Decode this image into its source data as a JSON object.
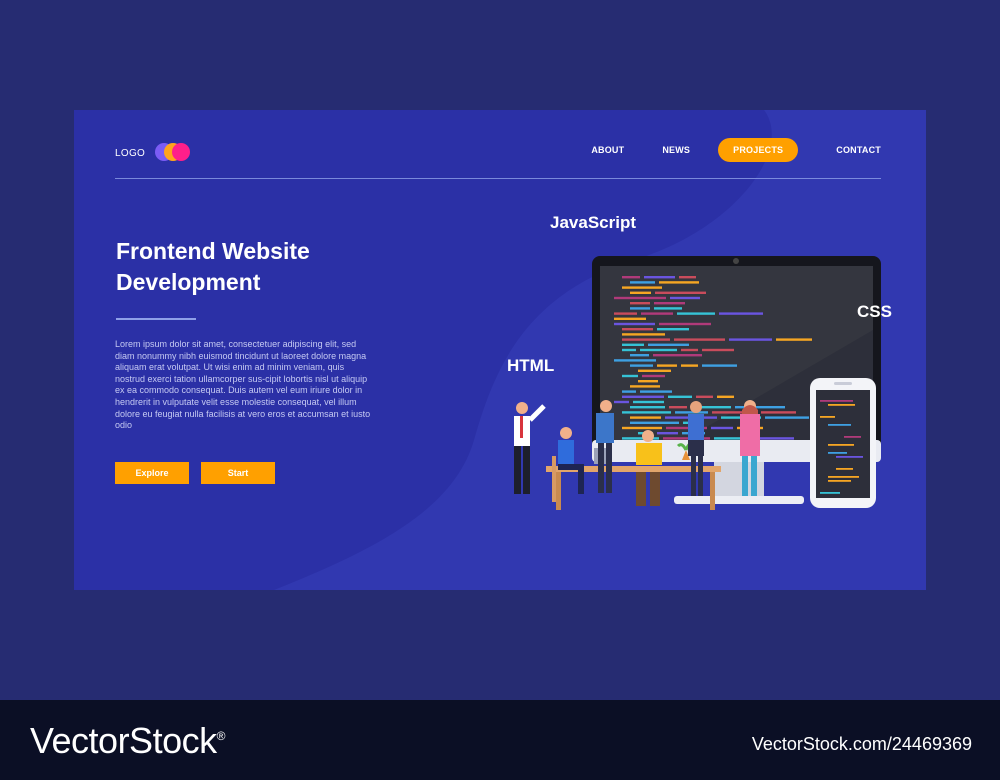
{
  "logo": {
    "text": "LOGO"
  },
  "nav": {
    "items": [
      {
        "label": "ABOUT",
        "active": false
      },
      {
        "label": "NEWS",
        "active": false
      },
      {
        "label": "PROJECTS",
        "active": true
      },
      {
        "label": "CONTACT",
        "active": false
      }
    ]
  },
  "hero": {
    "title": "Frontend Website Development",
    "body": "Lorem ipsum dolor sit amet, consectetuer adipiscing elit, sed diam nonummy nibh euismod tincidunt ut laoreet dolore magna aliquam erat volutpat. Ut wisi enim ad minim veniam, quis nostrud exerci tation ullamcorper sus-cipit lobortis nisl ut aliquip ex ea commodo consequat. Duis autem vel eum iriure dolor in hendrerit in vulputate velit esse molestie consequat, vel illum dolore eu feugiat nulla facilisis at vero eros et accumsan et iusto odio",
    "buttons": {
      "explore": "Explore",
      "start": "Start"
    }
  },
  "illustration": {
    "labels": {
      "js": "JavaScript",
      "html": "HTML",
      "css": "CSS"
    }
  },
  "footer": {
    "brand": "VectorStock",
    "trademark": "®",
    "image_id": "VectorStock.com/24469369"
  },
  "colors": {
    "background": "#262c72",
    "card": "#2b30a6",
    "accent": "#ffa000",
    "footer": "#0b0f25"
  }
}
